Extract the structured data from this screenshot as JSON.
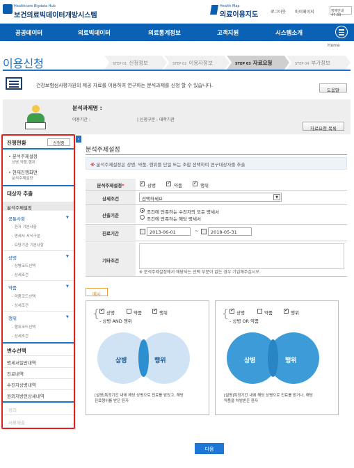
{
  "header": {
    "logo_small": "Healthcare Bigdata Hub",
    "logo_main": "보건의료빅데이터개방시스템",
    "hm_small": "Health Map",
    "hm_main": "의료이용지도",
    "login": "로그아웃",
    "mypage": "마이페이지",
    "time": "장애안내 47:39"
  },
  "nav": {
    "items": [
      "공공데이터",
      "의료빅데이터",
      "의료통계정보",
      "고객지원",
      "시스템소개"
    ],
    "home": "Home"
  },
  "page": {
    "title": "이용신청",
    "steps": [
      {
        "num": "STEP 01",
        "label": "신청정보"
      },
      {
        "num": "STEP 02",
        "label": "이용자정보"
      },
      {
        "num": "STEP 03",
        "label": "자료요청"
      },
      {
        "num": "STEP 04",
        "label": "부가정보"
      }
    ],
    "intro": "건강보험심사평가원의 제공 자료를 이용하여 연구하는 분석과제를 신청 할 수 있습니다.",
    "help": "도움말"
  },
  "info": {
    "title": "분석과제명 :",
    "period": "이용기간 :",
    "type": "| 신청구분 : 대학기관",
    "list_button": "자료요청 목록"
  },
  "sidebar": {
    "progress_title": "진행현황",
    "progress_badge": "신청중",
    "items": [
      {
        "label": "분석주제설정",
        "sub": "상병,약품,행위"
      },
      {
        "label": "현재진행화면",
        "sub": "분석주제설정"
      }
    ],
    "extract_title": "대상자 추출",
    "active": "분석주제설정",
    "common": "공통사항",
    "common_subs": [
      "환자 기본사항",
      "명세서 서식구분",
      "요양기관 기본사항"
    ],
    "disease": "상병",
    "disease_subs": [
      "상병코드선택",
      "상세조건"
    ],
    "drug": "약품",
    "drug_subs": [
      "약품코드선택",
      "상세조건"
    ],
    "procedure": "행위",
    "procedure_subs": [
      "행위코드선택",
      "상세조건"
    ],
    "var_title": "변수선택",
    "vars": [
      "명세서일반내역",
      "진료내역",
      "수진자상병내역",
      "원외처방전상세내역"
    ],
    "dim1": "정리",
    "dim2": "서류제출"
  },
  "main": {
    "title": "분석주제설정",
    "note": "분석주제설정은 상병, 약품, 행위를 단일 또는 조합 선택하여 연구대상자를 추출",
    "subject_label": "분석주제설정",
    "opt_disease": "상병",
    "opt_drug": "약품",
    "opt_procedure": "행위",
    "detail_label": "상세조건",
    "detail_select": "선택하세요",
    "extract_label": "산출기준",
    "radio1": "조건에 만족하는 수진자의 모든 명세서",
    "radio2": "조건에 만족하는 해당 명세서",
    "period_label": "진료기간",
    "date_from": "2013-06-01",
    "date_to": "2018-05-31",
    "etc_label": "기타조건",
    "hint": "※ 분석주제설정에서 해당되는 선택 부분이 없는 경우 기입해주십시오.",
    "example_tag": "예시",
    "next": "다음"
  },
  "examples": [
    {
      "cb1": "상병",
      "cb2": "약품",
      "cb3": "행위",
      "rule": "- 상병 AND 행위",
      "left": "상병",
      "right": "행위",
      "note1": "[설명]특정기간 내에 해당 상병으로 진료를 받았고, 해당",
      "note2": "진료행위를 받은 환자"
    },
    {
      "cb1": "상병",
      "cb2": "약품",
      "cb3": "행위",
      "rule": "- 상병 OR 약품",
      "left": "상병",
      "right": "행위",
      "note1": "[설명]특정기간 내에 해당 상병으로 진료를 받거나, 해당",
      "note2": "약품을 처방받은 환자"
    }
  ],
  "colors": {
    "brand_blue": "#0b62b5",
    "highlight_red": "#e02020",
    "venn_light": "#c6def2",
    "venn_mid": "#2c8fd0"
  }
}
